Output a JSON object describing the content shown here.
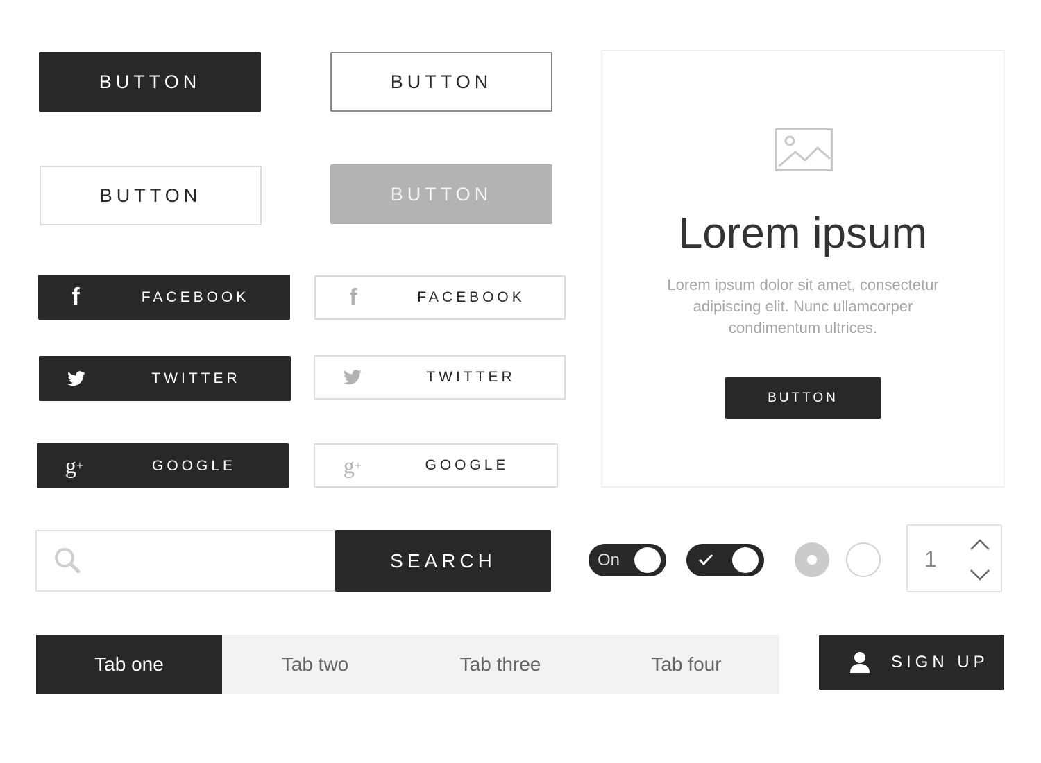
{
  "buttons": {
    "primary": "BUTTON",
    "outline_dark": "BUTTON",
    "outline_light": "BUTTON",
    "disabled": "BUTTON"
  },
  "social": {
    "facebook": "FACEBOOK",
    "twitter": "TWITTER",
    "google": "GOOGLE"
  },
  "card": {
    "title": "Lorem ipsum",
    "body": "Lorem ipsum dolor sit amet, consectetur adipiscing elit. Nunc ullamcorper condimentum ultrices.",
    "button": "BUTTON",
    "image_icon": "image-placeholder-icon"
  },
  "search": {
    "placeholder": "",
    "value": "",
    "button": "SEARCH"
  },
  "toggles": [
    {
      "label": "On",
      "state": true
    },
    {
      "icon": "check-icon",
      "state": true
    }
  ],
  "radios": [
    {
      "selected": true
    },
    {
      "selected": false
    }
  ],
  "stepper": {
    "value": "1"
  },
  "tabs": [
    {
      "label": "Tab one",
      "active": true
    },
    {
      "label": "Tab two"
    },
    {
      "label": "Tab three"
    },
    {
      "label": "Tab four"
    }
  ],
  "signup": {
    "label": "SIGN UP",
    "icon": "user-icon"
  },
  "colors": {
    "dark": "#282828",
    "disabled": "#b3b3b3",
    "tab_bg": "#f2f2f2",
    "muted_text": "#a6a6a6"
  }
}
